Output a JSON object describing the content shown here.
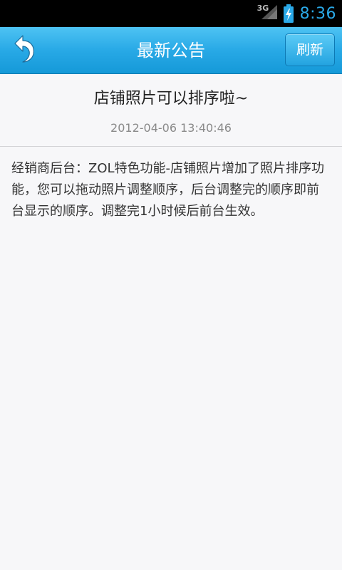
{
  "status_bar": {
    "network_type": "3G",
    "time": "8:36"
  },
  "header": {
    "title": "最新公告",
    "refresh_label": "刷新"
  },
  "article": {
    "title": "店铺照片可以排序啦~",
    "date": "2012-04-06 13:40:46",
    "body": "经销商后台：ZOL特色功能-店铺照片增加了照片排序功能，您可以拖动照片调整顺序，后台调整完的顺序即前台显示的顺序。调整完1小时候后前台生效。"
  },
  "colors": {
    "title_bar": "#28a9e6",
    "clock": "#2aa9e8",
    "background": "#f7f7f9"
  }
}
